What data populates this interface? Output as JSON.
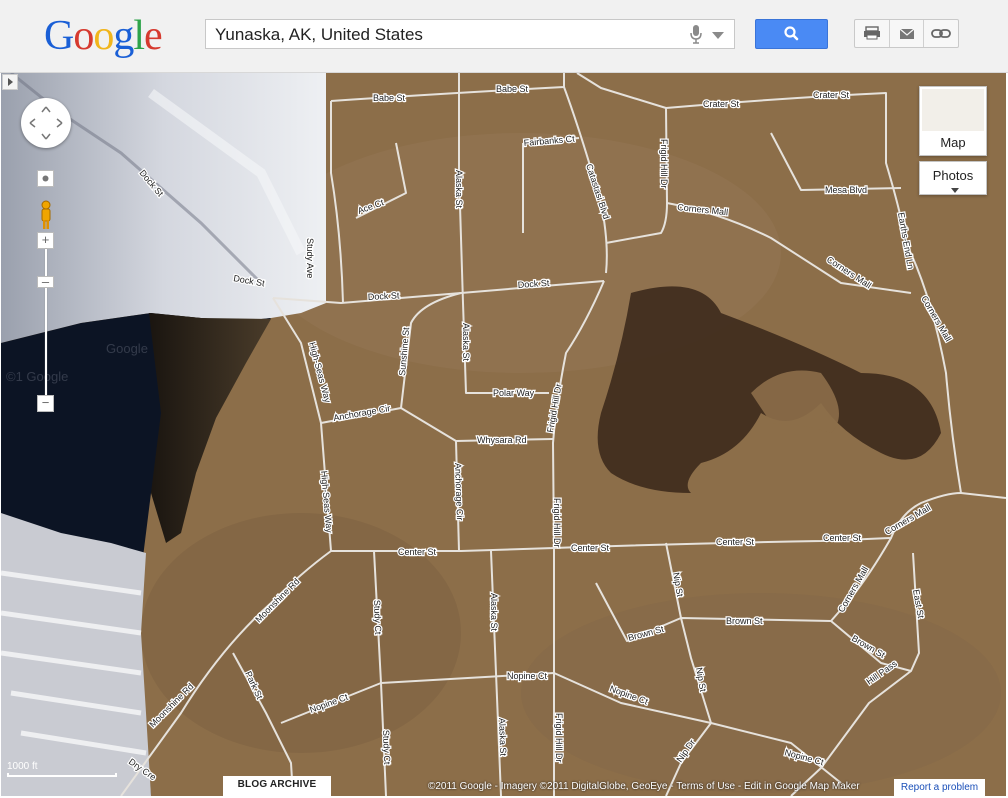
{
  "header": {
    "logo_text": "Google",
    "search_value": "Yunaska, AK, United States",
    "search_icon": "magnifier-icon",
    "tool_icons": [
      "print-icon",
      "email-icon",
      "link-icon"
    ]
  },
  "map": {
    "view": "satellite",
    "map_type_label": "Map",
    "photos_label": "Photos",
    "scale_label": "1000 ft",
    "blog_archive_label": "BLOG ARCHIVE",
    "attribution": "©2011 Google - Imagery ©2011 DigitalGlobe, GeoEye - Terms of Use - Edit in Google Map Maker",
    "report_label": "Report a problem",
    "watermarks": [
      "Google",
      "©1 Google"
    ],
    "colors": {
      "terrain": "#8c6e49",
      "road": "#e6e2dc",
      "water": "#0c1424",
      "accent": "#4a8af4"
    },
    "roads": [
      {
        "name": "Babe St",
        "labels": [
          "Babe St",
          "Babe St"
        ]
      },
      {
        "name": "Crater St",
        "labels": [
          "Crater St",
          "Crater St"
        ]
      },
      {
        "name": "Fairbanks Ct",
        "labels": [
          "Fairbanks Ct"
        ]
      },
      {
        "name": "Catastasis Blvd",
        "labels": [
          "Catastasi Blvd"
        ]
      },
      {
        "name": "Frigid Hill Dr",
        "labels": [
          "Frigid Hill Dr",
          "Frigid Hill Dr",
          "Frigid Hill Dr",
          "Frigid Hill Dr"
        ]
      },
      {
        "name": "Alaska St",
        "labels": [
          "Alaska St",
          "Alaska St",
          "Alaska St",
          "Alaska St"
        ]
      },
      {
        "name": "Ace Ct",
        "labels": [
          "Ace Ct"
        ]
      },
      {
        "name": "Mesa Blvd",
        "labels": [
          "Mesa Blvd"
        ]
      },
      {
        "name": "Corners Mall",
        "labels": [
          "Corners Mall",
          "Corners Mall",
          "Corners Mall",
          "Corners Mall",
          "Corners Mall"
        ]
      },
      {
        "name": "Earth's End Ln",
        "labels": [
          "Earths-End Ln"
        ]
      },
      {
        "name": "Dock St",
        "labels": [
          "Dock St",
          "Dock St",
          "Dock St",
          "Dock St"
        ]
      },
      {
        "name": "Study Ave",
        "labels": [
          "Study Ave"
        ]
      },
      {
        "name": "Sunshine St",
        "labels": [
          "Sunshine St"
        ]
      },
      {
        "name": "Polar Way",
        "labels": [
          "Polar Way"
        ]
      },
      {
        "name": "High Seas Way",
        "labels": [
          "High-Seas Way",
          "High-Seas Way"
        ]
      },
      {
        "name": "Anchorage Cir",
        "labels": [
          "Anchorage Cir",
          "Anchorage Cir"
        ]
      },
      {
        "name": "Whysara Rd",
        "labels": [
          "Whysara Rd"
        ]
      },
      {
        "name": "Center St",
        "labels": [
          "Center St",
          "Center St",
          "Center St",
          "Center St"
        ]
      },
      {
        "name": "Nip St",
        "labels": [
          "Nip St",
          "Nip St"
        ]
      },
      {
        "name": "Brown St",
        "labels": [
          "Brown St",
          "Brown St",
          "Brown St"
        ]
      },
      {
        "name": "East St",
        "labels": [
          "East St"
        ]
      },
      {
        "name": "Moonshine Rd",
        "labels": [
          "Moonshine Rd",
          "Moonshine Rd"
        ]
      },
      {
        "name": "Study Ct",
        "labels": [
          "Study Ct",
          "Study Ct"
        ]
      },
      {
        "name": "Park St",
        "labels": [
          "Park St"
        ]
      },
      {
        "name": "Nopine Ct",
        "labels": [
          "Nopine Ct",
          "Nopine Ct",
          "Nopine Ct",
          "Nopine Ct"
        ]
      },
      {
        "name": "Hill Pass",
        "labels": [
          "Hill Pass"
        ]
      },
      {
        "name": "Dry Cre",
        "labels": [
          "Dry Cre"
        ]
      },
      {
        "name": "Nip Dr",
        "labels": [
          "Nip Dr"
        ]
      }
    ]
  }
}
